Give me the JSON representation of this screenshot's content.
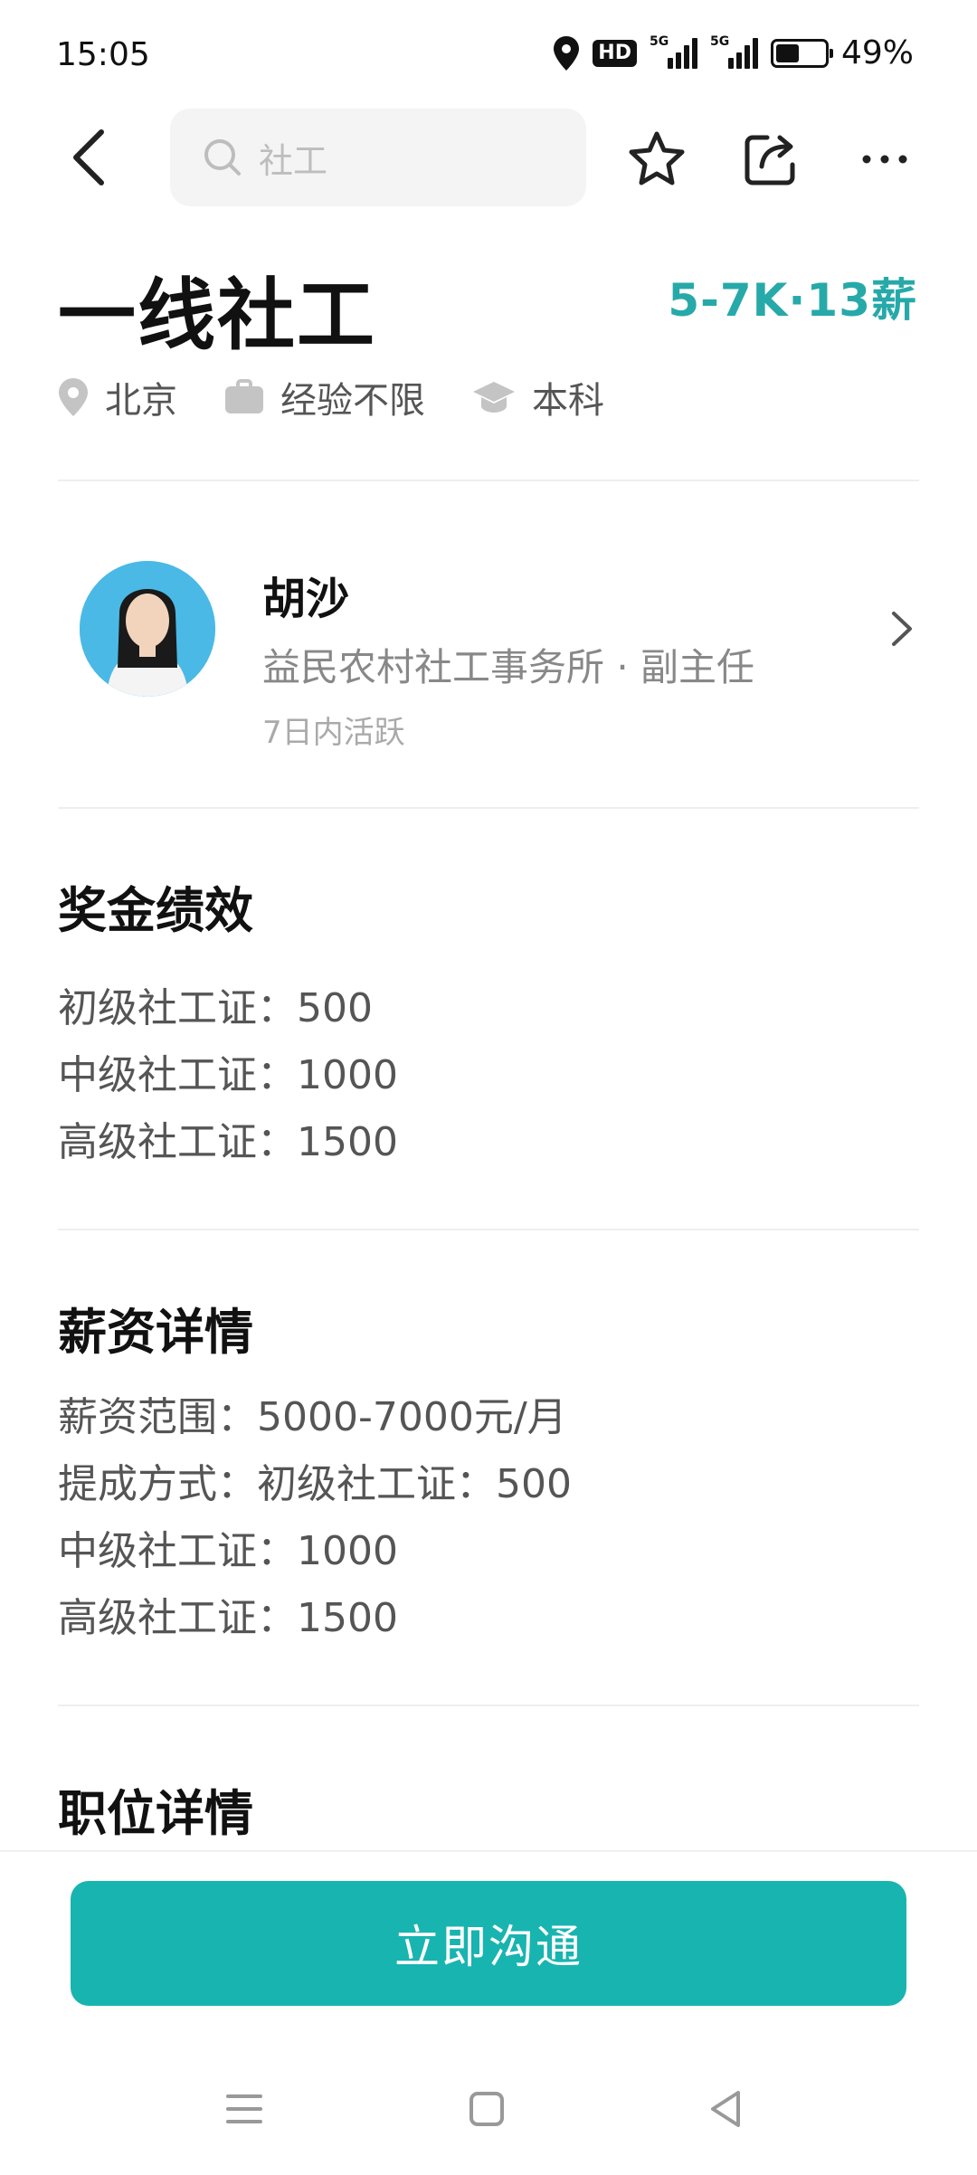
{
  "status_bar": {
    "time": "15:05",
    "hd_label": "HD",
    "network_1": "5G",
    "network_2": "5G",
    "battery_percent": "49%",
    "battery_level": 0.49
  },
  "nav": {
    "search_placeholder": "社工",
    "icons": [
      "back-icon",
      "search-icon",
      "star-icon",
      "share-icon",
      "more-icon"
    ]
  },
  "job": {
    "title": "一线社工",
    "salary": "5-7K·13薪",
    "location": "北京",
    "experience": "经验不限",
    "education": "本科"
  },
  "recruiter": {
    "name": "胡沙",
    "company_title": "益民农村社工事务所 · 副主任",
    "active_status": "7日内活跃"
  },
  "bonus": {
    "title": "奖金绩效",
    "lines": [
      "初级社工证：500",
      "中级社工证：1000",
      "高级社工证：1500"
    ]
  },
  "salary_details": {
    "title": "薪资详情",
    "lines": [
      "薪资范围：5000-7000元/月",
      "提成方式：初级社工证：500",
      "中级社工证：1000",
      "高级社工证：1500"
    ]
  },
  "position_details": {
    "title": "职位详情"
  },
  "action": {
    "chat_label": "立即沟通"
  },
  "colors": {
    "accent": "#18b4b0",
    "salary": "#27a9a9"
  }
}
